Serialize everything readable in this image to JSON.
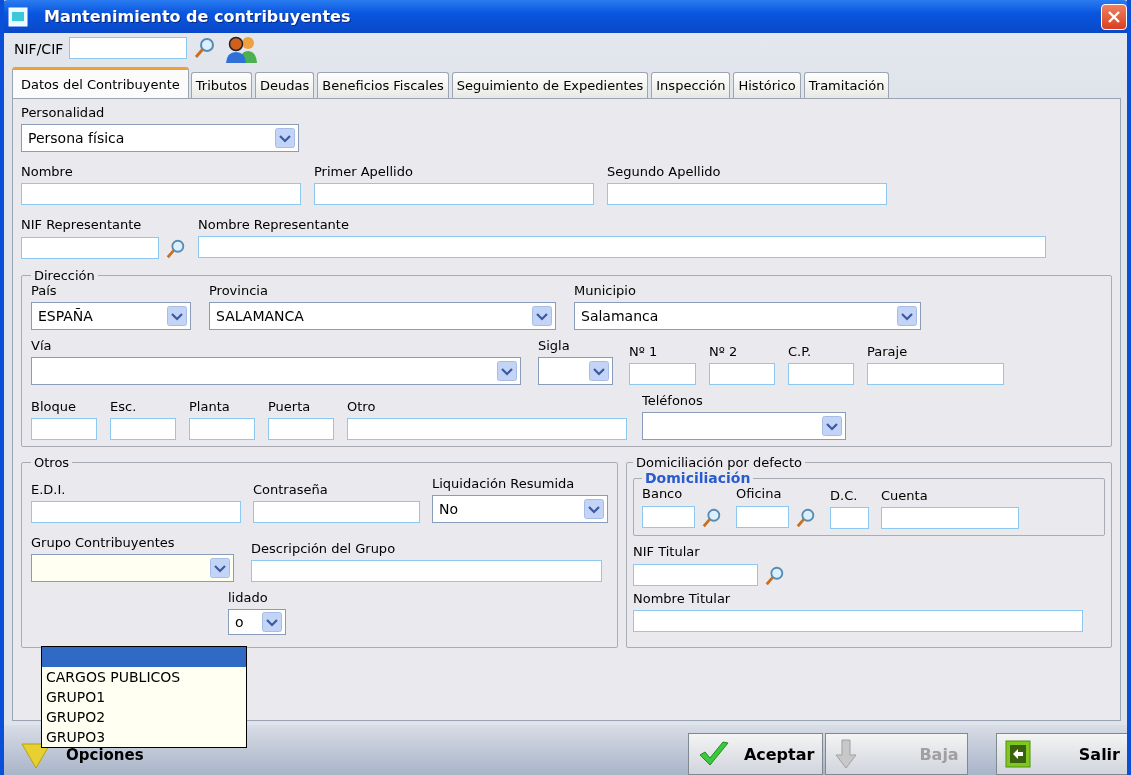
{
  "window": {
    "title": "Mantenimiento de contribuyentes"
  },
  "toolbar": {
    "nif_label": "NIF/CIF"
  },
  "tabs": [
    {
      "label": "Datos del Contribuyente",
      "selected": true
    },
    {
      "label": "Tributos",
      "selected": false
    },
    {
      "label": "Deudas",
      "selected": false
    },
    {
      "label": "Beneficios Fiscales",
      "selected": false
    },
    {
      "label": "Seguimiento de Expedientes",
      "selected": false
    },
    {
      "label": "Inspección",
      "selected": false
    },
    {
      "label": "Histórico",
      "selected": false
    },
    {
      "label": "Tramitación",
      "selected": false
    }
  ],
  "datos_rows": [
    [
      {
        "kind": "select",
        "label": "Personalidad",
        "value": "Persona física"
      }
    ],
    [
      {
        "kind": "text",
        "label": "Nombre"
      },
      {
        "kind": "text",
        "label": "Primer Apellido"
      },
      {
        "kind": "text",
        "label": "Segundo Apellido"
      }
    ],
    [
      {
        "kind": "lookup",
        "label": "NIF Representante"
      },
      {
        "kind": "text",
        "label": "Nombre Representante"
      }
    ]
  ],
  "direccion": {
    "title": "Dirección",
    "rows": [
      [
        {
          "kind": "select",
          "label": "País",
          "value": "ESPAÑA"
        },
        {
          "kind": "select",
          "label": "Provincia",
          "value": "SALAMANCA"
        },
        {
          "kind": "select",
          "label": "Municipio",
          "value": "Salamanca"
        }
      ],
      [
        {
          "kind": "select",
          "label": "Vía"
        },
        {
          "kind": "select",
          "label": "Sigla"
        },
        {
          "kind": "text",
          "label": "Nº 1"
        },
        {
          "kind": "text",
          "label": "Nº 2"
        },
        {
          "kind": "text",
          "label": "C.P."
        },
        {
          "kind": "text",
          "label": "Paraje"
        }
      ],
      [
        {
          "kind": "text",
          "label": "Bloque"
        },
        {
          "kind": "text",
          "label": "Esc."
        },
        {
          "kind": "text",
          "label": "Planta"
        },
        {
          "kind": "text",
          "label": "Puerta"
        },
        {
          "kind": "text",
          "label": "Otro"
        },
        {
          "kind": "select",
          "label": "Teléfonos"
        }
      ]
    ]
  },
  "otros": {
    "title": "Otros",
    "rows": [
      [
        {
          "kind": "text",
          "label": "E.D.I."
        },
        {
          "kind": "text",
          "label": "Contraseña"
        },
        {
          "kind": "select",
          "label": "Liquidación Resumida",
          "value": "No"
        }
      ],
      [
        {
          "kind": "select",
          "label": "Grupo Contribuyentes"
        },
        {
          "kind": "text",
          "label": "Descripción del Grupo"
        }
      ]
    ],
    "partial": {
      "label": "lidado",
      "value": "o"
    },
    "dropdown": [
      {
        "selected": true
      },
      {
        "label": "CARGOS PUBLICOS",
        "selected": false
      },
      {
        "label": "GRUPO1",
        "selected": false
      },
      {
        "label": "GRUPO2",
        "selected": false
      },
      {
        "label": "GRUPO3",
        "selected": false
      }
    ]
  },
  "domiciliacion": {
    "title": "Domiciliación por defecto",
    "inner_title": "Domiciliación",
    "inner_fields": [
      {
        "kind": "lookup",
        "label": "Banco"
      },
      {
        "kind": "lookup",
        "label": "Oficina"
      },
      {
        "kind": "text",
        "label": "D.C."
      },
      {
        "kind": "text",
        "label": "Cuenta"
      }
    ],
    "rows": [
      [
        {
          "kind": "lookup",
          "label": "NIF Titular"
        }
      ],
      [
        {
          "kind": "text",
          "label": "Nombre Titular"
        }
      ]
    ]
  },
  "footer": {
    "options_label": "Opciones",
    "buttons": [
      {
        "kind": "accept",
        "label": "Aceptar",
        "disabled": false
      },
      {
        "kind": "delete",
        "label": "Baja",
        "disabled": true
      },
      {
        "kind": "exit",
        "label": "Salir",
        "disabled": false
      }
    ]
  }
}
